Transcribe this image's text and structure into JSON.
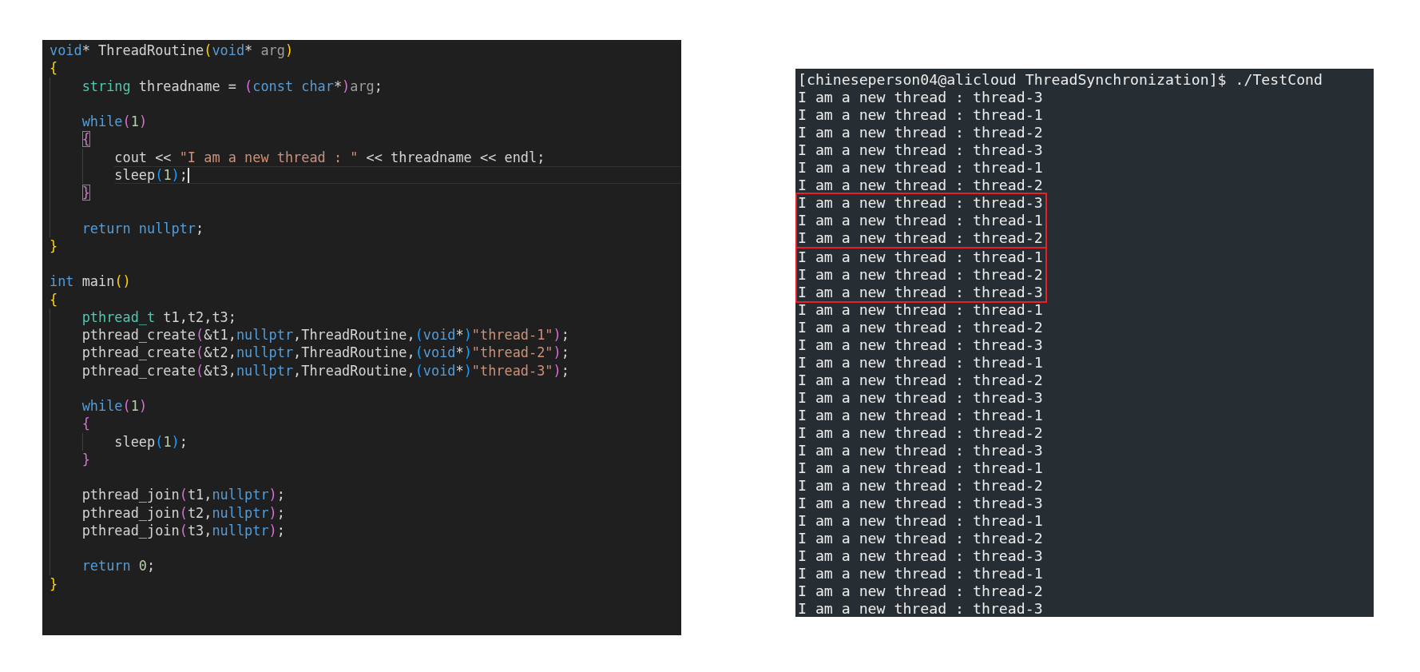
{
  "editor": {
    "lines": [
      {
        "current": false,
        "tokens": [
          {
            "text": "void",
            "kind": "kw"
          },
          {
            "text": "* ThreadRoutine",
            "kind": "plain"
          },
          {
            "text": "(",
            "kind": "p1"
          },
          {
            "text": "void",
            "kind": "kw"
          },
          {
            "text": "* ",
            "kind": "plain"
          },
          {
            "text": "arg",
            "kind": "param"
          },
          {
            "text": ")",
            "kind": "p1"
          }
        ]
      },
      {
        "current": false,
        "tokens": [
          {
            "text": "{",
            "kind": "p1"
          }
        ],
        "children": [
          {
            "current": false,
            "tokens": [
              {
                "text": "string",
                "kind": "type"
              },
              {
                "text": " threadname = ",
                "kind": "plain"
              },
              {
                "text": "(",
                "kind": "p2"
              },
              {
                "text": "const char",
                "kind": "kw"
              },
              {
                "text": "*",
                "kind": "plain"
              },
              {
                "text": ")",
                "kind": "p2"
              },
              {
                "text": "arg",
                "kind": "param"
              },
              {
                "text": ";",
                "kind": "plain"
              }
            ]
          },
          {
            "current": false
          },
          {
            "current": false,
            "tokens": [
              {
                "text": "while",
                "kind": "kw"
              },
              {
                "text": "(",
                "kind": "p2"
              },
              {
                "text": "1",
                "kind": "num"
              },
              {
                "text": ")",
                "kind": "p2"
              }
            ]
          },
          {
            "current": false,
            "tokens": [
              {
                "text": "{",
                "kind": "match2"
              }
            ],
            "children": [
              {
                "current": false,
                "tokens": [
                  {
                    "text": "cout << ",
                    "kind": "plain"
                  },
                  {
                    "text": "\"I am a new thread : \"",
                    "kind": "str"
                  },
                  {
                    "text": " << threadname << endl;",
                    "kind": "plain"
                  }
                ]
              },
              {
                "current": true,
                "tokens": [
                  {
                    "text": "sleep",
                    "kind": "plain"
                  },
                  {
                    "text": "(",
                    "kind": "p3"
                  },
                  {
                    "text": "1",
                    "kind": "num"
                  },
                  {
                    "text": ")",
                    "kind": "p3"
                  },
                  {
                    "text": ";",
                    "kind": "plain"
                  }
                ]
              }
            ]
          },
          {
            "current": false,
            "tokens": [
              {
                "text": "}",
                "kind": "match2"
              }
            ]
          },
          {
            "current": false
          },
          {
            "current": false,
            "tokens": [
              {
                "text": "return nullptr",
                "kind": "kw"
              },
              {
                "text": ";",
                "kind": "plain"
              }
            ]
          }
        ]
      },
      {
        "current": false,
        "tokens": [
          {
            "text": "}",
            "kind": "p1"
          }
        ]
      },
      {
        "current": false
      },
      {
        "current": false,
        "tokens": [
          {
            "text": "int",
            "kind": "kw"
          },
          {
            "text": " main",
            "kind": "plain"
          },
          {
            "text": "()",
            "kind": "p1"
          }
        ]
      },
      {
        "current": false,
        "tokens": [
          {
            "text": "{",
            "kind": "p1"
          }
        ],
        "children": [
          {
            "current": false,
            "tokens": [
              {
                "text": "pthread_t",
                "kind": "type"
              },
              {
                "text": " t1,t2,t3;",
                "kind": "plain"
              }
            ]
          },
          {
            "current": false,
            "tokens": [
              {
                "text": "pthread_create",
                "kind": "plain"
              },
              {
                "text": "(",
                "kind": "p2"
              },
              {
                "text": "&t1,",
                "kind": "plain"
              },
              {
                "text": "nullptr",
                "kind": "kw"
              },
              {
                "text": ",ThreadRoutine,",
                "kind": "plain"
              },
              {
                "text": "(",
                "kind": "p3"
              },
              {
                "text": "void",
                "kind": "kw"
              },
              {
                "text": "*",
                "kind": "plain"
              },
              {
                "text": ")",
                "kind": "p3"
              },
              {
                "text": "\"thread-1\"",
                "kind": "str"
              },
              {
                "text": ")",
                "kind": "p2"
              },
              {
                "text": ";",
                "kind": "plain"
              }
            ]
          },
          {
            "current": false,
            "tokens": [
              {
                "text": "pthread_create",
                "kind": "plain"
              },
              {
                "text": "(",
                "kind": "p2"
              },
              {
                "text": "&t2,",
                "kind": "plain"
              },
              {
                "text": "nullptr",
                "kind": "kw"
              },
              {
                "text": ",ThreadRoutine,",
                "kind": "plain"
              },
              {
                "text": "(",
                "kind": "p3"
              },
              {
                "text": "void",
                "kind": "kw"
              },
              {
                "text": "*",
                "kind": "plain"
              },
              {
                "text": ")",
                "kind": "p3"
              },
              {
                "text": "\"thread-2\"",
                "kind": "str"
              },
              {
                "text": ")",
                "kind": "p2"
              },
              {
                "text": ";",
                "kind": "plain"
              }
            ]
          },
          {
            "current": false,
            "tokens": [
              {
                "text": "pthread_create",
                "kind": "plain"
              },
              {
                "text": "(",
                "kind": "p2"
              },
              {
                "text": "&t3,",
                "kind": "plain"
              },
              {
                "text": "nullptr",
                "kind": "kw"
              },
              {
                "text": ",ThreadRoutine,",
                "kind": "plain"
              },
              {
                "text": "(",
                "kind": "p3"
              },
              {
                "text": "void",
                "kind": "kw"
              },
              {
                "text": "*",
                "kind": "plain"
              },
              {
                "text": ")",
                "kind": "p3"
              },
              {
                "text": "\"thread-3\"",
                "kind": "str"
              },
              {
                "text": ")",
                "kind": "p2"
              },
              {
                "text": ";",
                "kind": "plain"
              }
            ]
          },
          {
            "current": false
          },
          {
            "current": false,
            "tokens": [
              {
                "text": "while",
                "kind": "kw"
              },
              {
                "text": "(",
                "kind": "p2"
              },
              {
                "text": "1",
                "kind": "num"
              },
              {
                "text": ")",
                "kind": "p2"
              }
            ]
          },
          {
            "current": false,
            "tokens": [
              {
                "text": "{",
                "kind": "p2"
              }
            ],
            "children": [
              {
                "current": false,
                "tokens": [
                  {
                    "text": "sleep",
                    "kind": "plain"
                  },
                  {
                    "text": "(",
                    "kind": "p3"
                  },
                  {
                    "text": "1",
                    "kind": "num"
                  },
                  {
                    "text": ")",
                    "kind": "p3"
                  },
                  {
                    "text": ";",
                    "kind": "plain"
                  }
                ]
              }
            ]
          },
          {
            "current": false,
            "tokens": [
              {
                "text": "}",
                "kind": "p2"
              }
            ]
          },
          {
            "current": false
          },
          {
            "current": false,
            "tokens": [
              {
                "text": "pthread_join",
                "kind": "plain"
              },
              {
                "text": "(",
                "kind": "p2"
              },
              {
                "text": "t1,",
                "kind": "plain"
              },
              {
                "text": "nullptr",
                "kind": "kw"
              },
              {
                "text": ")",
                "kind": "p2"
              },
              {
                "text": ";",
                "kind": "plain"
              }
            ]
          },
          {
            "current": false,
            "tokens": [
              {
                "text": "pthread_join",
                "kind": "plain"
              },
              {
                "text": "(",
                "kind": "p2"
              },
              {
                "text": "t2,",
                "kind": "plain"
              },
              {
                "text": "nullptr",
                "kind": "kw"
              },
              {
                "text": ")",
                "kind": "p2"
              },
              {
                "text": ";",
                "kind": "plain"
              }
            ]
          },
          {
            "current": false,
            "tokens": [
              {
                "text": "pthread_join",
                "kind": "plain"
              },
              {
                "text": "(",
                "kind": "p2"
              },
              {
                "text": "t3,",
                "kind": "plain"
              },
              {
                "text": "nullptr",
                "kind": "kw"
              },
              {
                "text": ")",
                "kind": "p2"
              },
              {
                "text": ";",
                "kind": "plain"
              }
            ]
          },
          {
            "current": false
          },
          {
            "current": false,
            "tokens": [
              {
                "text": "return",
                "kind": "kw"
              },
              {
                "text": " 0",
                "kind": "num"
              },
              {
                "text": ";",
                "kind": "plain"
              }
            ]
          }
        ]
      },
      {
        "current": false,
        "tokens": [
          {
            "text": "}",
            "kind": "p1"
          }
        ]
      }
    ]
  },
  "terminal": {
    "blocks": [
      {
        "highlighted": false,
        "lines": [
          "[chineseperson04@alicloud ThreadSynchronization]$ ./TestCond",
          "I am a new thread : thread-3",
          "I am a new thread : thread-1",
          "I am a new thread : thread-2",
          "I am a new thread : thread-3",
          "I am a new thread : thread-1",
          "I am a new thread : thread-2"
        ]
      },
      {
        "highlighted": true,
        "lines": [
          "I am a new thread : thread-3",
          "I am a new thread : thread-1",
          "I am a new thread : thread-2"
        ]
      },
      {
        "highlighted": true,
        "lines": [
          "I am a new thread : thread-1",
          "I am a new thread : thread-2",
          "I am a new thread : thread-3"
        ]
      },
      {
        "highlighted": false,
        "lines": [
          "I am a new thread : thread-1",
          "I am a new thread : thread-2",
          "I am a new thread : thread-3",
          "I am a new thread : thread-1",
          "I am a new thread : thread-2",
          "I am a new thread : thread-3",
          "I am a new thread : thread-1",
          "I am a new thread : thread-2",
          "I am a new thread : thread-3",
          "I am a new thread : thread-1",
          "I am a new thread : thread-2",
          "I am a new thread : thread-3",
          "I am a new thread : thread-1",
          "I am a new thread : thread-2",
          "I am a new thread : thread-3",
          "I am a new thread : thread-1",
          "I am a new thread : thread-2",
          "I am a new thread : thread-3"
        ]
      }
    ]
  }
}
